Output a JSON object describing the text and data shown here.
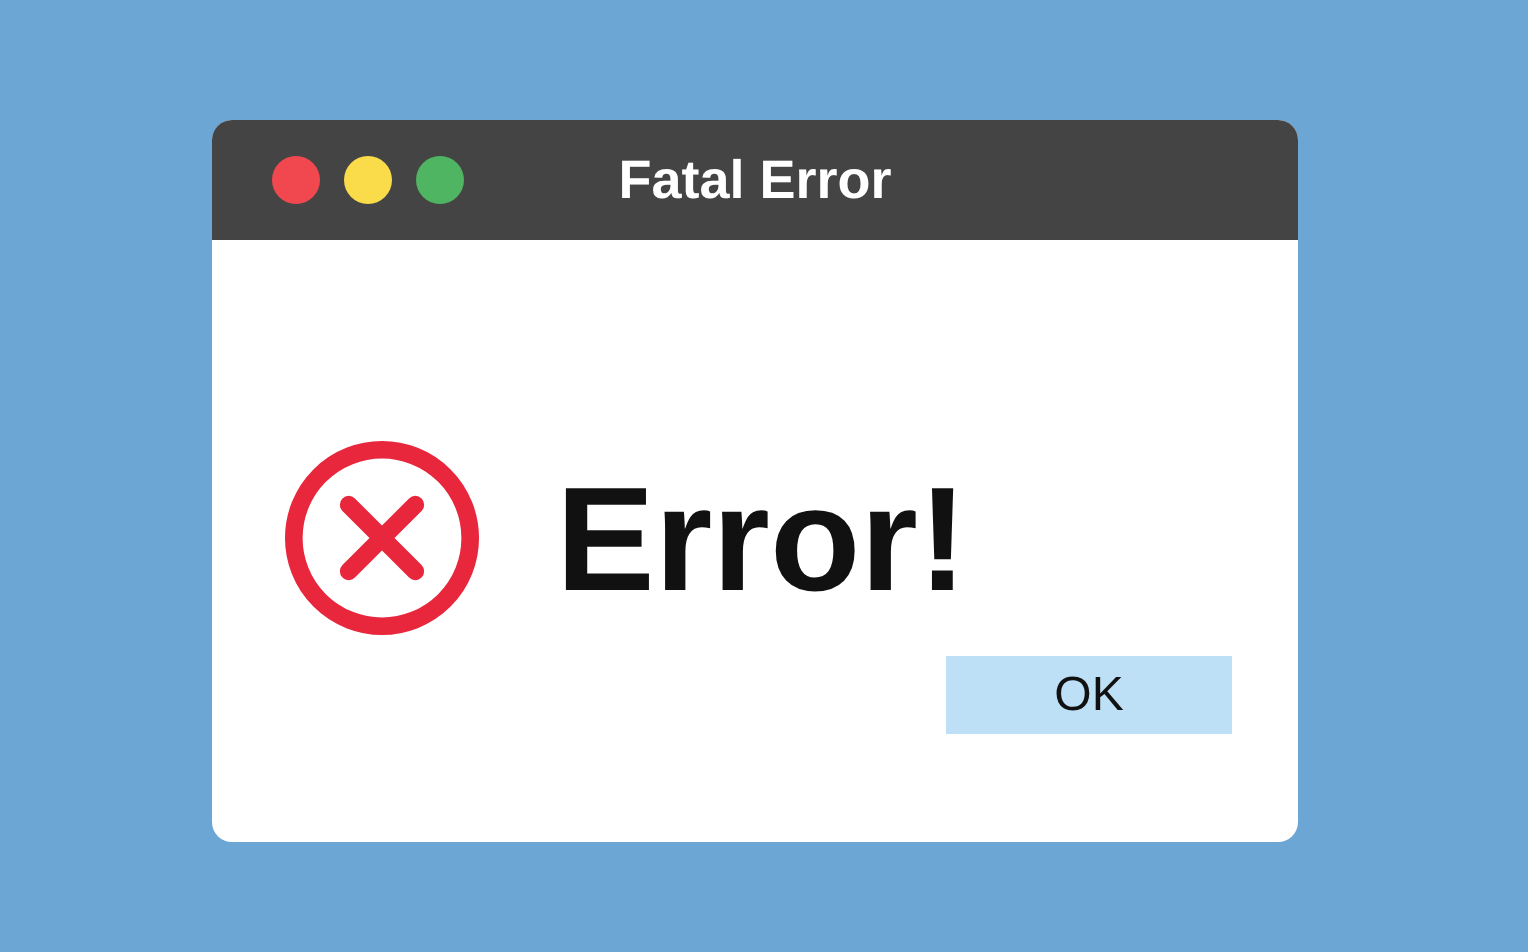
{
  "window": {
    "title": "Fatal Error"
  },
  "message": "Error!",
  "buttons": [
    "OK"
  ]
}
